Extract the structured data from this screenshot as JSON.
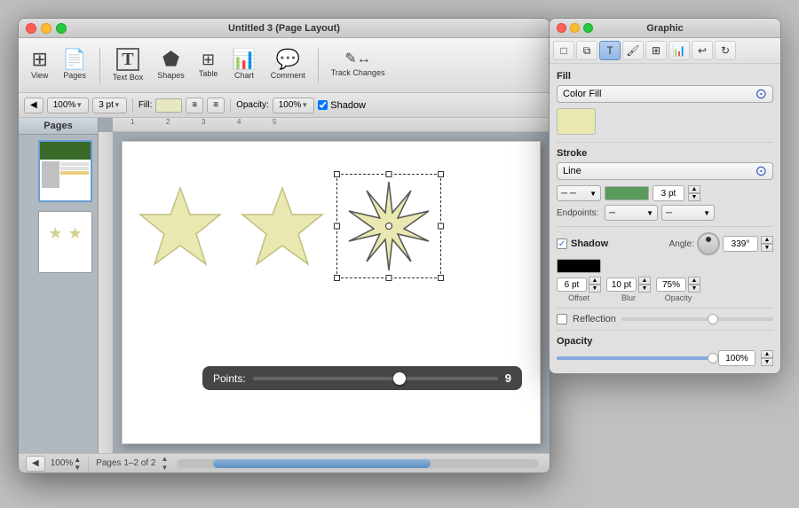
{
  "window": {
    "title": "Untitled 3 (Page Layout)",
    "traffic_lights": [
      "close",
      "minimize",
      "maximize"
    ]
  },
  "toolbar": {
    "view_label": "View",
    "pages_label": "Pages",
    "textbox_label": "Text Box",
    "shapes_label": "Shapes",
    "table_label": "Table",
    "chart_label": "Chart",
    "comment_label": "Comment",
    "track_changes_label": "Track Changes"
  },
  "format_bar": {
    "zoom": "100%",
    "fill_label": "Fill:",
    "opacity_label": "Opacity:",
    "shadow_label": "Shadow",
    "pages_label": "Pages 1–2 of 2"
  },
  "sidebar": {
    "title": "Pages",
    "pages": [
      "1",
      "2"
    ]
  },
  "canvas": {
    "stars": [
      {
        "id": "star1",
        "points": 5,
        "fill": "#e8e8b0",
        "stroke": "#c8c890"
      },
      {
        "id": "star2",
        "points": 5,
        "fill": "#e8e8b0",
        "stroke": "#c8c890"
      },
      {
        "id": "star3",
        "points": 9,
        "fill": "#e8e8b0",
        "stroke": "#444",
        "selected": true
      }
    ],
    "points_tooltip": {
      "label": "Points:",
      "value": "9"
    }
  },
  "graphic_panel": {
    "title": "Graphic",
    "fill_section": {
      "title": "Fill",
      "type": "Color Fill",
      "color": "#e8e8b0"
    },
    "stroke_section": {
      "title": "Stroke",
      "type": "Line",
      "color": "#5a9a5a",
      "width": "3 pt"
    },
    "endpoints_label": "Endpoints:",
    "shadow_section": {
      "title": "Shadow",
      "checked": true,
      "angle": "339°",
      "color": "#000000",
      "offset": "6 pt",
      "blur": "10 pt",
      "opacity_val": "75%"
    },
    "reflection_section": {
      "title": "Reflection",
      "checked": false
    },
    "opacity_section": {
      "title": "Opacity",
      "value": "100%"
    }
  },
  "status": {
    "zoom": "100%",
    "pages": "Pages 1–2 of 2"
  }
}
